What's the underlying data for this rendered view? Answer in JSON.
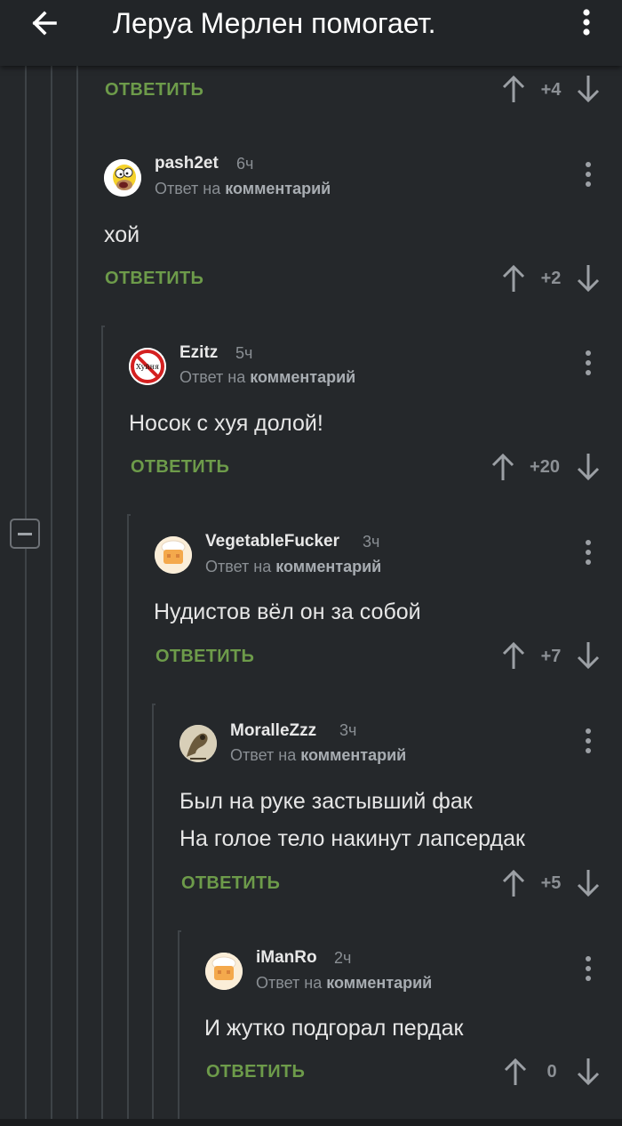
{
  "appbar": {
    "title": "Леруа Мерлен помогает."
  },
  "labels": {
    "reply": "ОТВЕТИТЬ",
    "reply_to_prefix": "Ответ на",
    "reply_to_target": "комментарий"
  },
  "top_comment": {
    "score": "+4"
  },
  "comments": [
    {
      "username": "pash2et",
      "time": "6ч",
      "lines": [
        "хой"
      ],
      "score": "+2",
      "avatar_icon": "simpson-avatar-icon"
    },
    {
      "username": "Ezitz",
      "time": "5ч",
      "lines": [
        "Носок с хуя долой!"
      ],
      "score": "+20",
      "avatar_icon": "prohibited-sign-avatar-icon",
      "avatar_text": "Хуйня"
    },
    {
      "username": "VegetableFucker",
      "time": "3ч",
      "lines": [
        "Нудистов вёл он за собой"
      ],
      "score": "+7",
      "avatar_icon": "chef-avatar-icon"
    },
    {
      "username": "MoralleZzz",
      "time": "3ч",
      "lines": [
        "Был на руке застывший фак",
        "На голое тело накинут лапсердак"
      ],
      "score": "+5",
      "avatar_icon": "drawing-avatar-icon"
    },
    {
      "username": "iManRo",
      "time": "2ч",
      "lines": [
        "И жутко подгорал пердак"
      ],
      "score": "0",
      "avatar_icon": "chef-avatar-icon"
    }
  ],
  "colors": {
    "background": "#25282b",
    "appbar": "#222528",
    "reply_green": "#6d9b4a",
    "muted": "#8a8f94",
    "thread_line": "#3e4347"
  }
}
